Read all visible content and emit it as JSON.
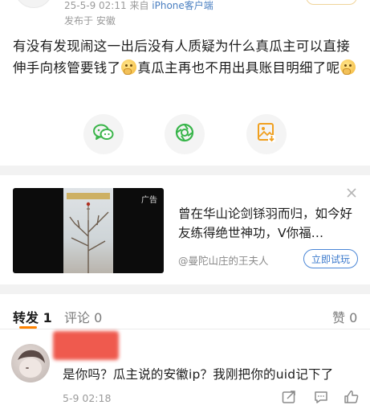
{
  "post": {
    "date": "25-5-9 02:11",
    "source_prefix": "来自",
    "source_client": "iPhone客户端",
    "location": "发布于 安徽",
    "text_part1": "有没有发现闹这一出后没有人质疑为什么真瓜主可以直接伸手向核管要钱了",
    "text_part2": "真瓜主再也不用出具账目明细了呢"
  },
  "share": {
    "icons": [
      "wechat-icon",
      "moments-icon",
      "save-image-icon"
    ]
  },
  "ad": {
    "tag": "广告",
    "title": "曾在华山论剑铩羽而归，如今好友练得绝世神功，V你福…",
    "author": "@曼陀山庄的王夫人",
    "cta": "立即试玩"
  },
  "tabs": {
    "repost": "转发 1",
    "comment": "评论 0",
    "like": "赞 0"
  },
  "comment": {
    "text": "是你吗？瓜主说的安徽ip？我刚把你的uid记下了",
    "time": "5-9 02:18"
  },
  "colors": {
    "accent": "#ff8200",
    "link": "#4a7fc1",
    "wechat": "#3bb54a",
    "moments": "#38b54a",
    "image_save": "#f0a020"
  }
}
